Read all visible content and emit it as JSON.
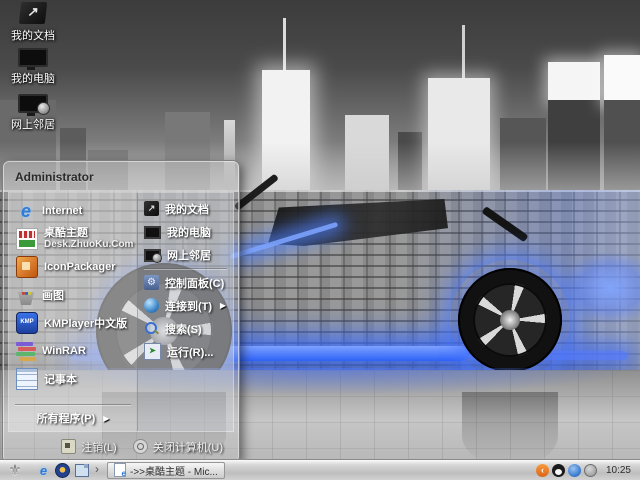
{
  "desktop": {
    "icons": [
      {
        "label": "我的文档"
      },
      {
        "label": "我的电脑"
      },
      {
        "label": "网上邻居"
      }
    ]
  },
  "start_menu": {
    "user_name": "Administrator",
    "left_items": [
      {
        "label": "Internet"
      },
      {
        "label": "桌酷主题",
        "sublabel": "Desk.ZhuoKu.Com"
      },
      {
        "label": "IconPackager"
      },
      {
        "label": "画图"
      },
      {
        "label": "KMPlayer中文版"
      },
      {
        "label": "WinRAR"
      },
      {
        "label": "记事本"
      }
    ],
    "all_programs": {
      "label": "所有程序(P)"
    },
    "right_items": [
      {
        "label": "我的文档"
      },
      {
        "label": "我的电脑"
      },
      {
        "label": "网上邻居"
      },
      {
        "label": "控制面板(C)"
      },
      {
        "label": "连接到(T)"
      },
      {
        "label": "搜索(S)"
      },
      {
        "label": "运行(R)..."
      }
    ],
    "footer": {
      "logoff": "注销(L)",
      "shutdown": "关闭计算机(U)"
    }
  },
  "taskbar": {
    "task_button_label": "->>桌酷主题 - Mic...",
    "clock": "10:25"
  },
  "icons": {
    "start_fleur": "⚜",
    "menu_arrow": "▶",
    "overflow_chevron": "›",
    "ie_letter": "e",
    "kmp_text": "KMP",
    "doc_arrow": "↗",
    "gear": "⚙",
    "run_arrow": "➤",
    "sogou_mark": "‹"
  },
  "colors": {
    "neon_blue": "#3a6cf5",
    "taskbar_silver": "#c9c9c9",
    "menu_glass": "rgba(205,205,205,0.35)",
    "wall_gray": "#939393"
  }
}
